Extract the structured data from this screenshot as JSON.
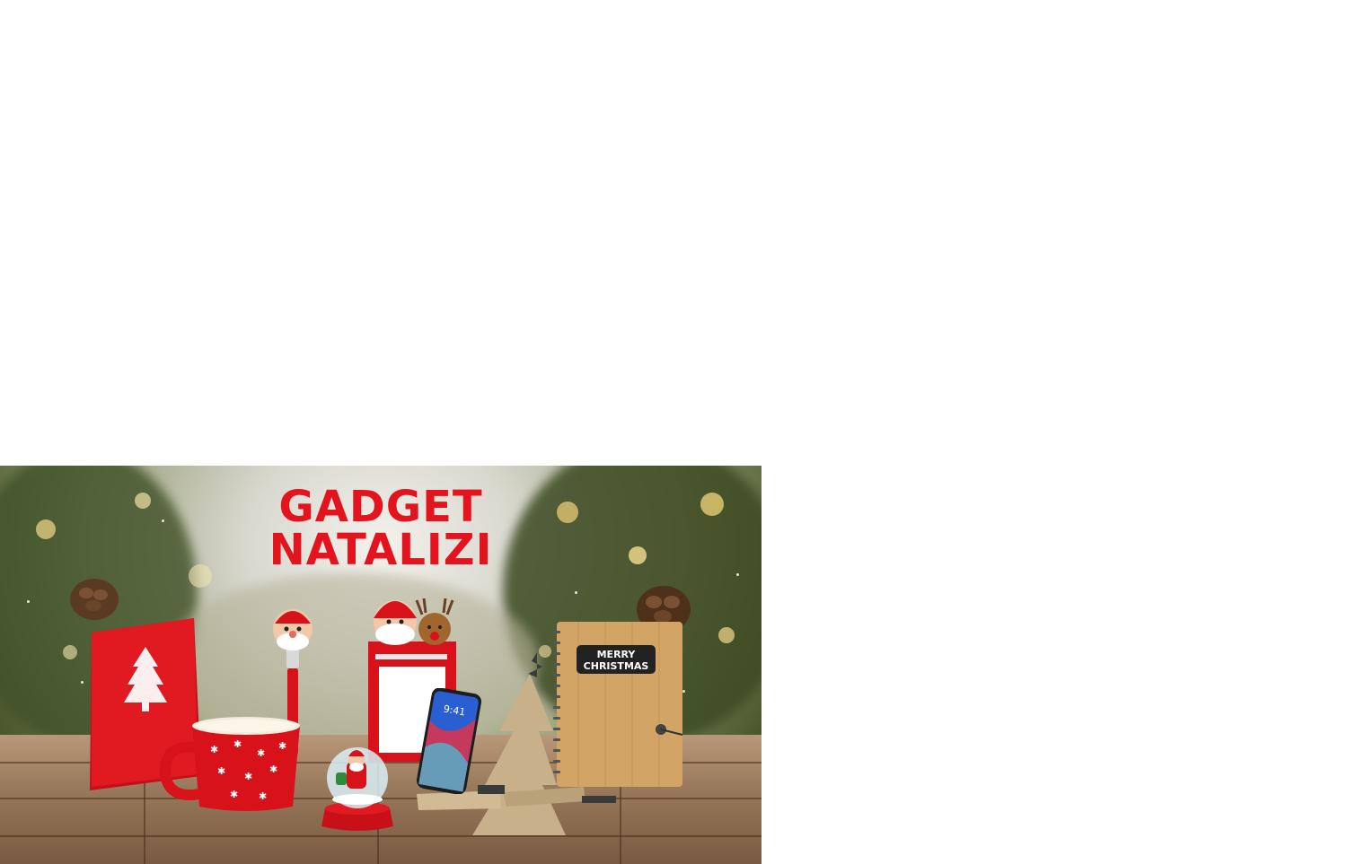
{
  "banner": {
    "title_line1": "GADGET",
    "title_line2": "NATALIZI",
    "title_color": "#e3141d"
  },
  "products": [
    {
      "name": "red-notebook-with-tree",
      "color": "#d8121b"
    },
    {
      "name": "santa-pen",
      "color": "#d8121b"
    },
    {
      "name": "red-enamel-mug",
      "color": "#d8121b"
    },
    {
      "name": "snow-globe-santa",
      "color": "#c81018"
    },
    {
      "name": "santa-reindeer-memo-holder",
      "color": "#d8121b"
    },
    {
      "name": "smartphone",
      "color": "#222222"
    },
    {
      "name": "wooden-tree-phone-stand",
      "color": "#c8b08a"
    },
    {
      "name": "bamboo-notebook",
      "color": "#d2a566"
    }
  ],
  "notebook_badge": {
    "line1": "MERRY",
    "line2": "CHRISTMAS"
  },
  "phone_time": "9:41"
}
